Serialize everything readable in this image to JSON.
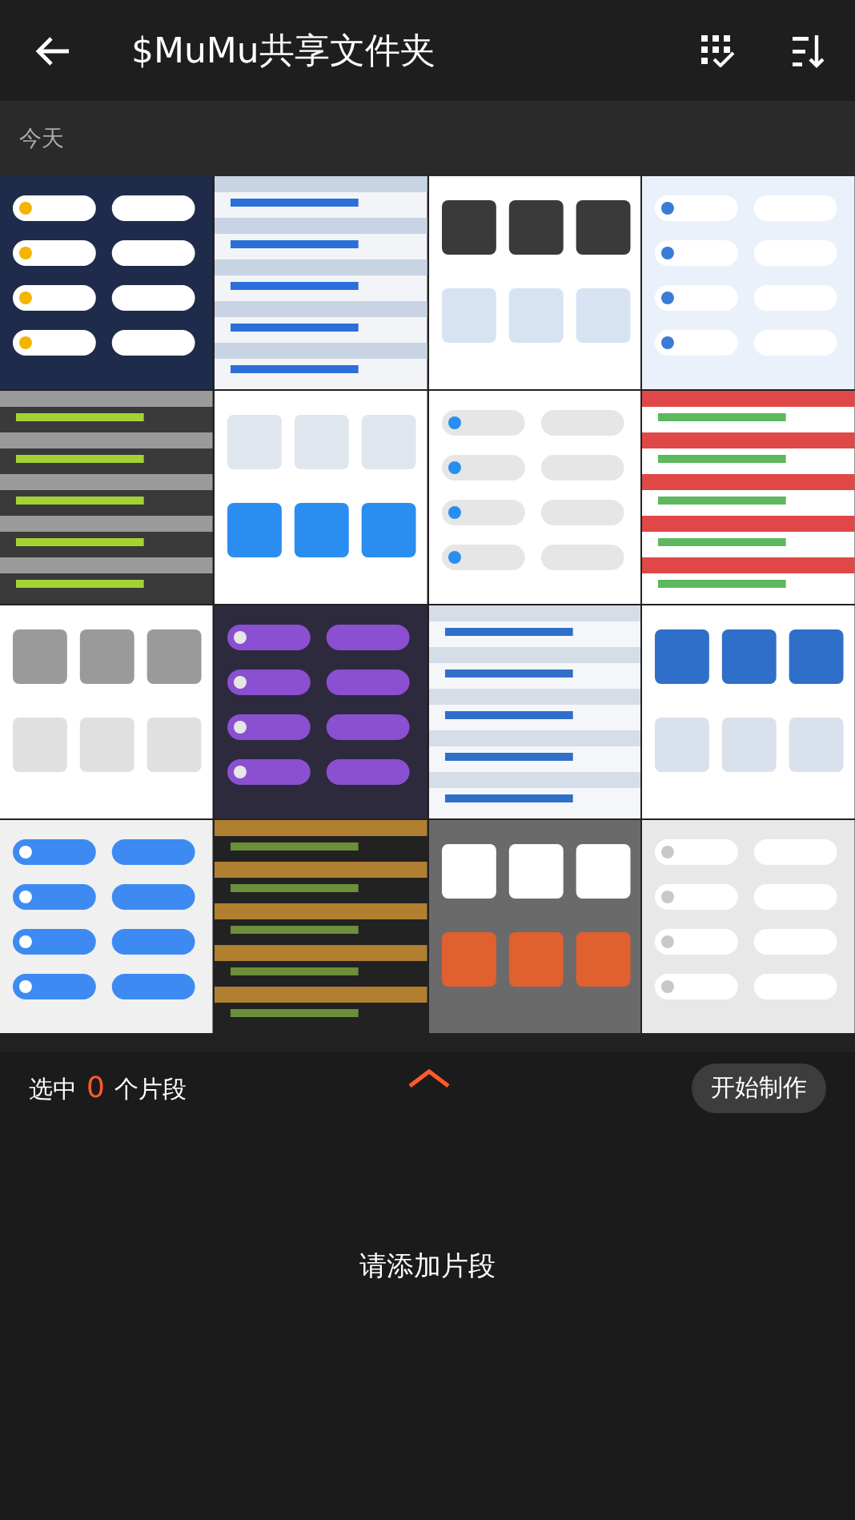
{
  "header": {
    "title": "$MuMu共享文件夹"
  },
  "section": {
    "label": "今天"
  },
  "selection": {
    "prefix": "选中",
    "count": "0",
    "suffix": "个片段"
  },
  "start_button": "开始制作",
  "empty_hint": "请添加片段"
}
